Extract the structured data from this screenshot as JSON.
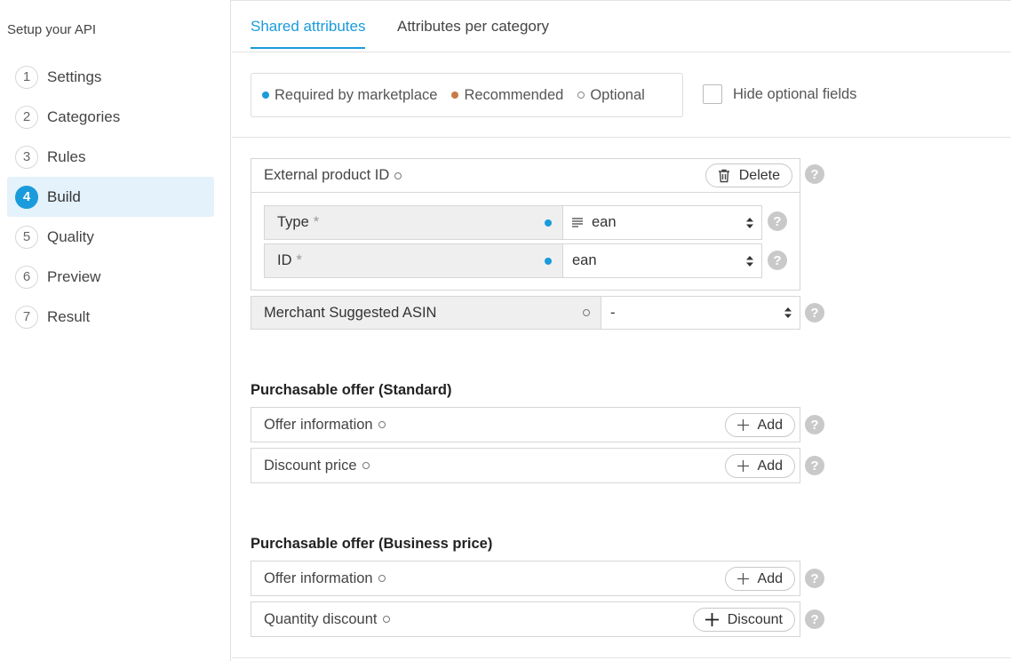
{
  "sidebar": {
    "title": "Setup your API",
    "steps": [
      {
        "num": "1",
        "label": "Settings"
      },
      {
        "num": "2",
        "label": "Categories"
      },
      {
        "num": "3",
        "label": "Rules"
      },
      {
        "num": "4",
        "label": "Build"
      },
      {
        "num": "5",
        "label": "Quality"
      },
      {
        "num": "6",
        "label": "Preview"
      },
      {
        "num": "7",
        "label": "Result"
      }
    ],
    "active_step": "4"
  },
  "tabs": [
    {
      "label": "Shared attributes",
      "active": true
    },
    {
      "label": "Attributes per category",
      "active": false
    }
  ],
  "legend": {
    "required": "Required by marketplace",
    "recommended": "Recommended",
    "optional": "Optional",
    "colors": {
      "required": "#1a9bdb",
      "recommended": "#c87a45"
    }
  },
  "hide_optional": {
    "label": "Hide optional fields",
    "checked": false
  },
  "external_product": {
    "title": "External product ID",
    "delete_label": "Delete",
    "fields": [
      {
        "label": "Type",
        "required_mark": "*",
        "value": "ean",
        "icon": "list-icon"
      },
      {
        "label": "ID",
        "required_mark": "*",
        "value": "ean"
      }
    ]
  },
  "merchant_asin": {
    "label": "Merchant Suggested ASIN",
    "value": "-"
  },
  "section_standard": {
    "title": "Purchasable offer (Standard)",
    "rows": [
      {
        "label": "Offer information",
        "button": "Add"
      },
      {
        "label": "Discount price",
        "button": "Add"
      }
    ]
  },
  "section_business": {
    "title": "Purchasable offer (Business price)",
    "rows": [
      {
        "label": "Offer information",
        "button": "Add"
      },
      {
        "label": "Quantity discount",
        "button": "Discount"
      }
    ]
  },
  "help_glyph": "?"
}
